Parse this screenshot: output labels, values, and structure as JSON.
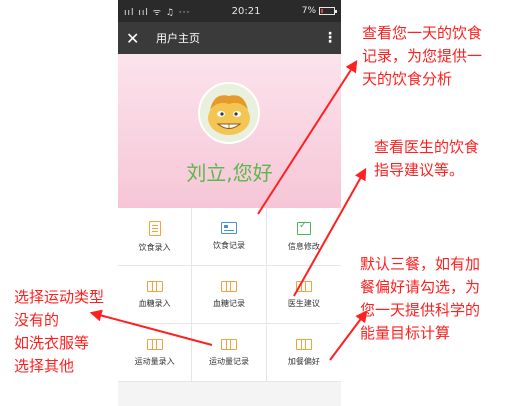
{
  "status_bar": {
    "signal": "ııl ııl ᯤ ♫ ···",
    "time": "20:21",
    "battery": "7%",
    "battery_level": 0.07
  },
  "app_bar": {
    "close_icon": "✕",
    "title": "用户主页",
    "menu_icon": "⋮"
  },
  "profile": {
    "avatar": "cartoon-face-avatar",
    "greeting": "刘立,您好"
  },
  "menu": [
    {
      "label": "饮食录入",
      "icon": "doc"
    },
    {
      "label": "饮食记录",
      "icon": "card"
    },
    {
      "label": "信息修改",
      "icon": "check"
    },
    {
      "label": "血糖录入",
      "icon": "grid3"
    },
    {
      "label": "血糖记录",
      "icon": "grid3"
    },
    {
      "label": "医生建议",
      "icon": "grid3"
    },
    {
      "label": "运动量录入",
      "icon": "grid3"
    },
    {
      "label": "运动量记录",
      "icon": "grid3"
    },
    {
      "label": "加餐偏好",
      "icon": "grid3"
    }
  ],
  "annotations": {
    "record": [
      "查看您一天的饮食",
      "记录，为您提供一",
      "天的饮食分析"
    ],
    "doctor": [
      "查看医生的饮食",
      "指导建议等。"
    ],
    "meal": [
      "默认三餐，如有加",
      "餐偏好请勾选，为",
      "您一天提供科学的",
      "能量目标计算"
    ],
    "exercise": [
      "选择运动类型",
      "没有的",
      "如洗衣服等",
      "选择其他"
    ]
  },
  "colors": {
    "annotation": "#ff2020",
    "greeting": "#5db84a",
    "app_bar": "#3a3a3a"
  }
}
